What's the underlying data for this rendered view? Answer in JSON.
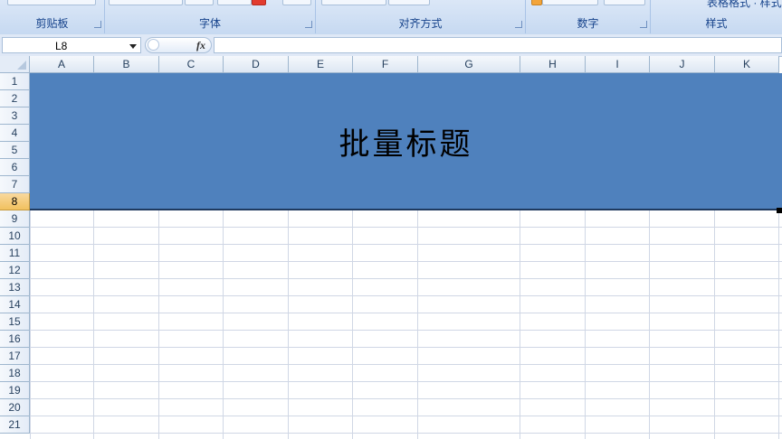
{
  "ribbon": {
    "groups": [
      {
        "label": "剪贴板"
      },
      {
        "label": "字体"
      },
      {
        "label": "对齐方式"
      },
      {
        "label": "数字"
      },
      {
        "label": "样式"
      }
    ],
    "partial_top_text": "表格格式 · 样式"
  },
  "formula_bar": {
    "name_box": "L8",
    "fx_label": "fx",
    "formula": ""
  },
  "sheet": {
    "columns": [
      "A",
      "B",
      "C",
      "D",
      "E",
      "F",
      "G",
      "H",
      "I",
      "J",
      "K"
    ],
    "rows": [
      "1",
      "2",
      "3",
      "4",
      "5",
      "6",
      "7",
      "8",
      "9",
      "10",
      "11",
      "12",
      "13",
      "14",
      "15",
      "16",
      "17",
      "18",
      "19",
      "20",
      "21"
    ],
    "active_row": "8",
    "merged_title": "批量标题",
    "title_fill_color": "#4f81bd"
  }
}
